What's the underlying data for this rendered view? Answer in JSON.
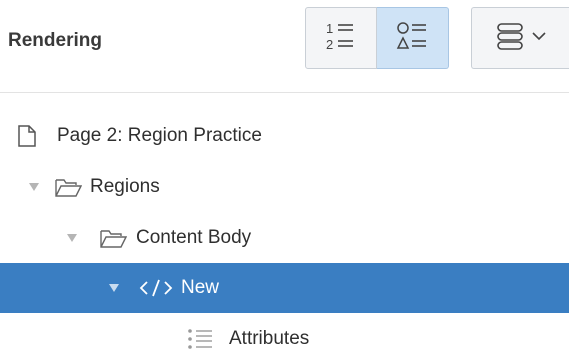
{
  "header": {
    "title": "Rendering",
    "view_buttons": [
      {
        "name": "numbered-list-view",
        "icon": "numbered-list-icon"
      },
      {
        "name": "shapes-list-view",
        "icon": "shapes-list-icon",
        "selected": true
      }
    ],
    "menu_button": {
      "icon": "stacked-menu-icon",
      "chevron": "chevron-down-icon"
    }
  },
  "tree": {
    "items": [
      {
        "label": "Page 2: Region Practice",
        "icon": "page-icon",
        "level": 0,
        "expandable": false
      },
      {
        "label": "Regions",
        "icon": "folder-open-icon",
        "level": 1,
        "expandable": true,
        "expanded": true
      },
      {
        "label": "Content Body",
        "icon": "folder-open-icon",
        "level": 2,
        "expandable": true,
        "expanded": true
      },
      {
        "label": "New",
        "icon": "code-tag-icon",
        "level": 3,
        "expandable": true,
        "expanded": true,
        "selected": true
      },
      {
        "label": "Attributes",
        "icon": "attributes-list-icon",
        "level": 4,
        "expandable": false
      }
    ]
  },
  "colors": {
    "selected_row": "#3a7ec2",
    "selected_button": "#cfe3f6",
    "text": "#2f2f2f"
  }
}
